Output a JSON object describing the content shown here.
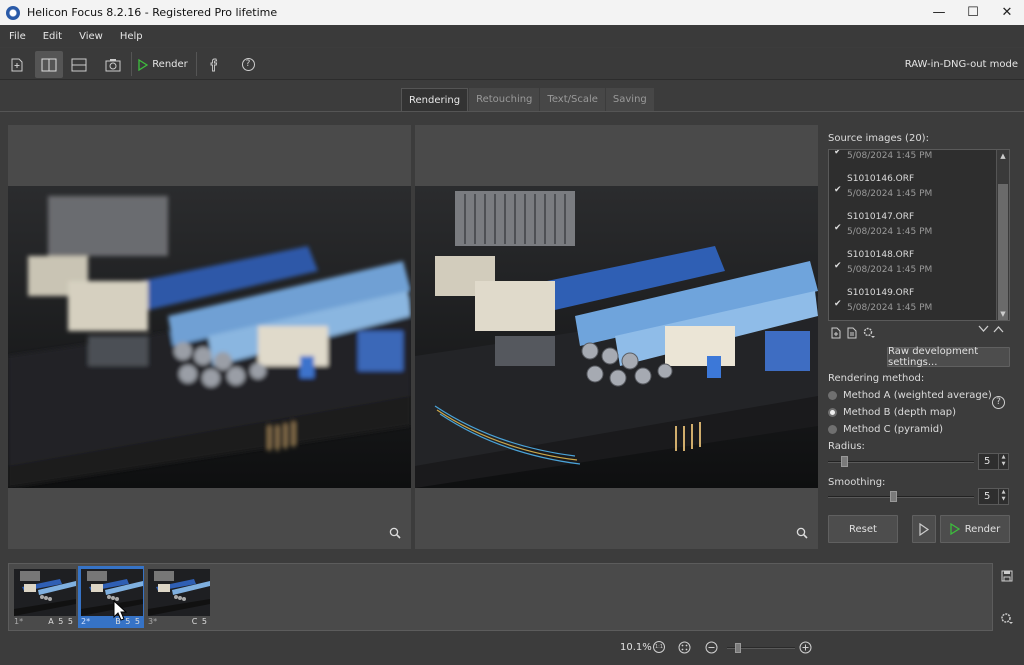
{
  "window": {
    "title": "Helicon Focus 8.2.16 - Registered Pro lifetime",
    "minimize": "—",
    "maximize": "☐",
    "close": "✕"
  },
  "menu": [
    "File",
    "Edit",
    "View",
    "Help"
  ],
  "toolbar": {
    "render_label": "Render",
    "mode_label": "RAW-in-DNG-out mode"
  },
  "tabs": [
    {
      "label": "Rendering",
      "active": true
    },
    {
      "label": "Retouching",
      "active": false
    },
    {
      "label": "Text/Scale",
      "active": false
    },
    {
      "label": "Saving",
      "active": false
    }
  ],
  "source": {
    "header": "Source images (20):",
    "items": [
      {
        "name": "",
        "date": "5/08/2024 1:45 PM",
        "checked": true
      },
      {
        "name": "S1010146.ORF",
        "date": "5/08/2024 1:45 PM",
        "checked": true
      },
      {
        "name": "S1010147.ORF",
        "date": "5/08/2024 1:45 PM",
        "checked": true
      },
      {
        "name": "S1010148.ORF",
        "date": "5/08/2024 1:45 PM",
        "checked": true
      },
      {
        "name": "S1010149.ORF",
        "date": "5/08/2024 1:45 PM",
        "checked": true
      }
    ]
  },
  "raw_button": "Raw development settings...",
  "rendering": {
    "label": "Rendering method:",
    "methods": [
      {
        "label": "Method A (weighted average)",
        "selected": false
      },
      {
        "label": "Method B (depth map)",
        "selected": true
      },
      {
        "label": "Method C (pyramid)",
        "selected": false
      }
    ]
  },
  "radius": {
    "label": "Radius:",
    "value": "5"
  },
  "smoothing": {
    "label": "Smoothing:",
    "value": "5"
  },
  "buttons": {
    "reset": "Reset",
    "render": "Render"
  },
  "thumbnails": [
    {
      "index": "1*",
      "meta": "A 5 5",
      "selected": false
    },
    {
      "index": "2*",
      "meta": "B 5 5",
      "selected": true
    },
    {
      "index": "3*",
      "meta": "C 5",
      "selected": false
    }
  ],
  "status": {
    "zoom": "10.1%",
    "fit_icon": "1:1"
  },
  "colors": {
    "accent": "#3673c6",
    "render_green": "#3dbd3d"
  }
}
